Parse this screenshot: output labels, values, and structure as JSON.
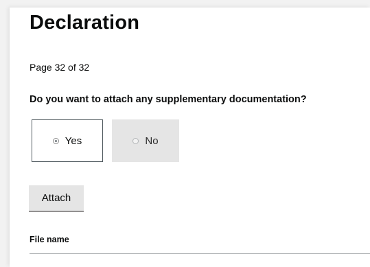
{
  "page": {
    "title": "Declaration",
    "page_count": "Page 32 of 32"
  },
  "question": {
    "text": "Do you want to attach any supplementary documentation?",
    "options": [
      {
        "label": "Yes",
        "selected": true
      },
      {
        "label": "No",
        "selected": false
      }
    ]
  },
  "actions": {
    "attach_label": "Attach"
  },
  "files_table": {
    "columns": [
      "File name"
    ],
    "rows": []
  },
  "colors": {
    "text": "#0b0c0c",
    "selected_border": "#505a5f",
    "unselected_bg": "#e5e5e5",
    "button_bg": "#e5e5e5",
    "divider": "#b1b4b6"
  }
}
